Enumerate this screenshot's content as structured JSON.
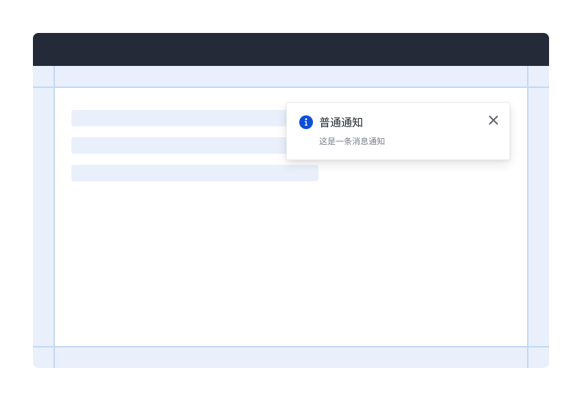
{
  "notification": {
    "title": "普通通知",
    "message": "这是一条消息通知",
    "icon": "info-icon",
    "icon_color": "#0e4fd8",
    "close_icon": "close-icon"
  },
  "colors": {
    "titlebar": "#242a37",
    "frame_bg": "#e9f0fb",
    "guide_line": "#c1d7f5",
    "content_bg": "#ffffff",
    "skeleton": "#e9f0fb"
  }
}
